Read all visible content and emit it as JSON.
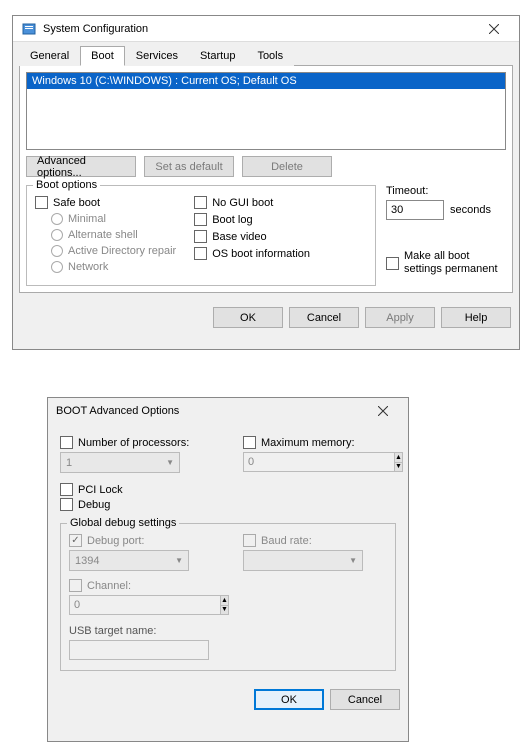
{
  "win1": {
    "title": "System Configuration",
    "tabs": [
      "General",
      "Boot",
      "Services",
      "Startup",
      "Tools"
    ],
    "active_tab": "Boot",
    "list_entry": "Windows 10 (C:\\WINDOWS) : Current OS; Default OS",
    "btn_advanced": "Advanced options...",
    "btn_setdefault": "Set as default",
    "btn_delete": "Delete",
    "bootopts_legend": "Boot options",
    "safe_boot": "Safe boot",
    "minimal": "Minimal",
    "altshell": "Alternate shell",
    "adrepair": "Active Directory repair",
    "network": "Network",
    "nogui": "No GUI boot",
    "bootlog": "Boot log",
    "basevideo": "Base video",
    "osbootinfo": "OS boot information",
    "timeout_lbl": "Timeout:",
    "timeout_val": "30",
    "seconds": "seconds",
    "makeperm": "Make all boot settings permanent",
    "ok": "OK",
    "cancel": "Cancel",
    "apply": "Apply",
    "help": "Help"
  },
  "win2": {
    "title": "BOOT Advanced Options",
    "numproc": "Number of processors:",
    "numproc_val": "1",
    "maxmem": "Maximum memory:",
    "maxmem_val": "0",
    "pcilock": "PCI Lock",
    "debug": "Debug",
    "gds_legend": "Global debug settings",
    "debugport": "Debug port:",
    "debugport_val": "1394",
    "baudrate": "Baud rate:",
    "baudrate_val": "",
    "channel": "Channel:",
    "channel_val": "0",
    "usbtarget": "USB target name:",
    "ok": "OK",
    "cancel": "Cancel"
  }
}
